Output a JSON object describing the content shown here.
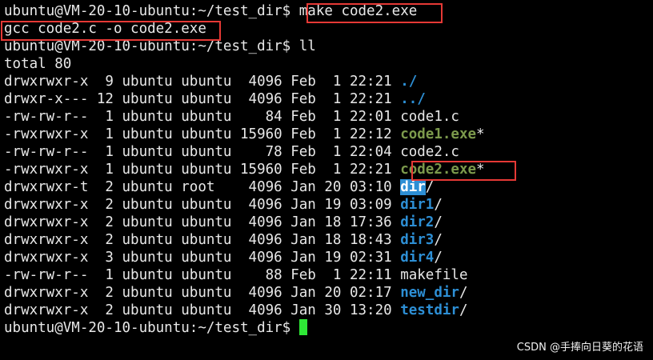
{
  "terminal": {
    "line_height": 22,
    "lines": [
      {
        "segments": [
          {
            "text": "ubuntu@VM-20-10-ubuntu:~/test_dir$ ",
            "style": "default"
          },
          {
            "text": "make code2.exe",
            "style": "default"
          }
        ]
      },
      {
        "segments": [
          {
            "text": "gcc code2.c -o code2.exe",
            "style": "default"
          }
        ]
      },
      {
        "segments": [
          {
            "text": "ubuntu@VM-20-10-ubuntu:~/test_dir$ ll",
            "style": "default"
          }
        ]
      },
      {
        "segments": [
          {
            "text": "total 80",
            "style": "default"
          }
        ]
      },
      {
        "segments": [
          {
            "text": "drwxrwxr-x  9 ubuntu ubuntu  4096 Feb  1 22:21 ",
            "style": "default"
          },
          {
            "text": "./",
            "style": "dir"
          }
        ]
      },
      {
        "segments": [
          {
            "text": "drwxr-x--- 12 ubuntu ubuntu  4096 Feb  1 22:21 ",
            "style": "default"
          },
          {
            "text": "../",
            "style": "dir"
          }
        ]
      },
      {
        "segments": [
          {
            "text": "-rw-rw-r--  1 ubuntu ubuntu    84 Feb  1 22:01 ",
            "style": "default"
          },
          {
            "text": "code1.c",
            "style": "default"
          }
        ]
      },
      {
        "segments": [
          {
            "text": "-rwxrwxr-x  1 ubuntu ubuntu 15960 Feb  1 22:12 ",
            "style": "default"
          },
          {
            "text": "code1.exe",
            "style": "exe"
          },
          {
            "text": "*",
            "style": "exe-star"
          }
        ]
      },
      {
        "segments": [
          {
            "text": "-rw-rw-r--  1 ubuntu ubuntu    78 Feb  1 22:04 ",
            "style": "default"
          },
          {
            "text": "code2.c",
            "style": "default"
          }
        ]
      },
      {
        "segments": [
          {
            "text": "-rwxrwxr-x  1 ubuntu ubuntu 15960 Feb  1 22:21 ",
            "style": "default"
          },
          {
            "text": "code2.exe",
            "style": "exe"
          },
          {
            "text": "*",
            "style": "exe-star"
          }
        ]
      },
      {
        "segments": [
          {
            "text": "drwxrwxr-t  2 ubuntu root    4096 Jan 20 03:10 ",
            "style": "default"
          },
          {
            "text": "dir",
            "style": "dir-hl"
          },
          {
            "text": "/",
            "style": "default"
          }
        ]
      },
      {
        "segments": [
          {
            "text": "drwxrwxr-x  2 ubuntu ubuntu  4096 Jan 19 03:09 ",
            "style": "default"
          },
          {
            "text": "dir1",
            "style": "dir"
          },
          {
            "text": "/",
            "style": "default"
          }
        ]
      },
      {
        "segments": [
          {
            "text": "drwxrwxr-x  2 ubuntu ubuntu  4096 Jan 18 17:36 ",
            "style": "default"
          },
          {
            "text": "dir2",
            "style": "dir"
          },
          {
            "text": "/",
            "style": "default"
          }
        ]
      },
      {
        "segments": [
          {
            "text": "drwxrwxr-x  2 ubuntu ubuntu  4096 Jan 18 18:43 ",
            "style": "default"
          },
          {
            "text": "dir3",
            "style": "dir"
          },
          {
            "text": "/",
            "style": "default"
          }
        ]
      },
      {
        "segments": [
          {
            "text": "drwxrwxr-x  3 ubuntu ubuntu  4096 Jan 19 02:31 ",
            "style": "default"
          },
          {
            "text": "dir4",
            "style": "dir"
          },
          {
            "text": "/",
            "style": "default"
          }
        ]
      },
      {
        "segments": [
          {
            "text": "-rw-rw-r--  1 ubuntu ubuntu    88 Feb  1 22:11 ",
            "style": "default"
          },
          {
            "text": "makefile",
            "style": "default"
          }
        ]
      },
      {
        "segments": [
          {
            "text": "drwxrwxr-x  2 ubuntu ubuntu  4096 Jan 20 02:17 ",
            "style": "default"
          },
          {
            "text": "new_dir",
            "style": "dir"
          },
          {
            "text": "/",
            "style": "default"
          }
        ]
      },
      {
        "segments": [
          {
            "text": "drwxrwxr-x  2 ubuntu ubuntu  4096 Jan 30 13:20 ",
            "style": "default"
          },
          {
            "text": "testdir",
            "style": "dir"
          },
          {
            "text": "/",
            "style": "default"
          }
        ]
      },
      {
        "segments": [
          {
            "text": "ubuntu@VM-20-10-ubuntu:~/test_dir$ ",
            "style": "default"
          }
        ],
        "cursor": true
      }
    ]
  },
  "colors": {
    "background": "#000000",
    "text": "#e8e8e8",
    "directory": "#2d8fd5",
    "executable": "#7c9a4c",
    "cursor": "#2ee836",
    "annotation": "#e53935"
  },
  "watermark": "CSDN @手捧向日葵的花语"
}
